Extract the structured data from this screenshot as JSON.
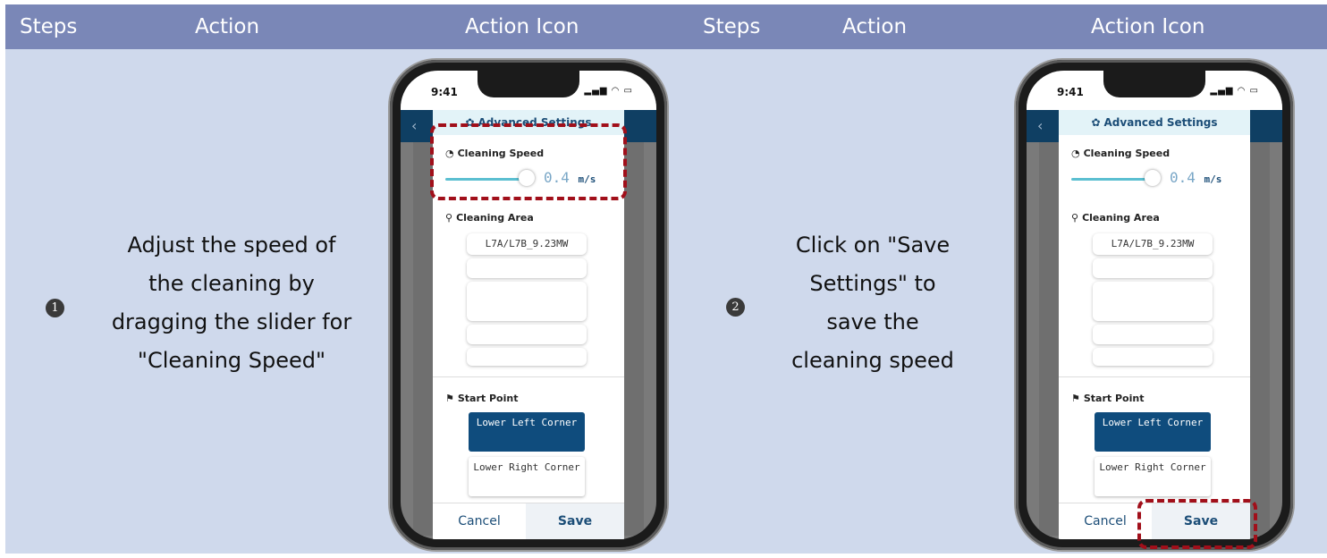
{
  "header": {
    "col1": "Steps",
    "col2": "Action",
    "col3": "Action Icon",
    "col4": "Steps",
    "col5": "Action",
    "col6": "Action Icon"
  },
  "colors": {
    "header_bg": "#7a87b7",
    "body_bg": "#cfd9ec",
    "highlight": "#a10f1a",
    "primary": "#0f4c7d"
  },
  "steps": [
    {
      "number": "1",
      "action": "Adjust the speed of the cleaning by dragging the slider for \"Cleaning Speed\""
    },
    {
      "number": "2",
      "action": "Click on \"Save Settings\" to save the cleaning speed"
    }
  ],
  "phone": {
    "time": "9:41",
    "modal_title": "Advanced Settings",
    "speed_label": "Cleaning Speed",
    "speed_value": "0.4",
    "speed_unit": "m/s",
    "speed_slider_fraction": 0.88,
    "area_label": "Cleaning Area",
    "area_selected": "L7A/L7B_9.23MW",
    "start_label": "Start Point",
    "start_option_1": "Lower Left Corner",
    "start_option_2": "Lower Right Corner",
    "cancel_label": "Cancel",
    "save_label": "Save"
  },
  "icons": [
    "gear-icon",
    "speedometer-icon",
    "location-pin-icon",
    "flag-icon",
    "back-chevron-icon",
    "signal-icon",
    "wifi-icon",
    "battery-icon"
  ]
}
